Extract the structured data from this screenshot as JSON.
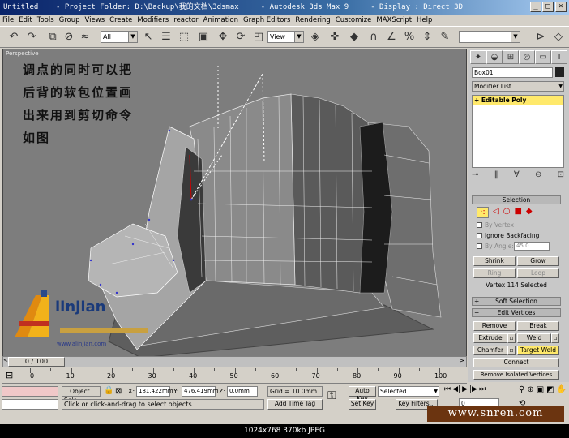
{
  "window": {
    "title": "Untitled    - Project Folder: D:\\Backup\\我的文档\\3dsmax     - Autodesk 3ds Max 9     - Display : Direct 3D",
    "buttons": [
      "_",
      "□",
      "×"
    ]
  },
  "menu": [
    "File",
    "Edit",
    "Tools",
    "Group",
    "Views",
    "Create",
    "Modifiers",
    "reactor",
    "Animation",
    "Graph Editors",
    "Rendering",
    "Customize",
    "MAXScript",
    "Help"
  ],
  "toolbar": {
    "selection_filter": "All",
    "ref_coord": "View"
  },
  "viewport": {
    "label": "Perspective",
    "note_lines": [
      "调点的同时可以把",
      "后背的软包位置画",
      "出来用到剪切命令",
      "如图"
    ],
    "logo": {
      "name": "linjian",
      "url": "www.alinjian.com"
    }
  },
  "command_panel": {
    "object_name": "Box01",
    "modifier_list": "Modifier List",
    "stack_item": "Editable Poly",
    "selection": {
      "header": "Selection",
      "by_vertex": "By Vertex",
      "ignore_backfacing": "Ignore Backfacing",
      "by_angle": "By Angle:",
      "angle_value": "45.0",
      "shrink": "Shrink",
      "grow": "Grow",
      "ring": "Ring",
      "loop": "Loop",
      "status": "Vertex 114 Selected"
    },
    "soft_selection": {
      "header": "Soft Selection"
    },
    "edit_vertices": {
      "header": "Edit Vertices",
      "remove": "Remove",
      "break": "Break",
      "extrude": "Extrude",
      "weld": "Weld",
      "chamfer": "Chamfer",
      "target_weld": "Target Weld",
      "connect": "Connect",
      "remove_isolated": "Remove Isolated Vertices"
    }
  },
  "timeline": {
    "slider_label": "0 / 100",
    "ticks": [
      "0",
      "10",
      "20",
      "30",
      "40",
      "50",
      "60",
      "70",
      "80",
      "90",
      "100"
    ]
  },
  "status": {
    "selection_count": "1 Object Sele",
    "x_label": "X:",
    "x_value": "181.422mm",
    "y_label": "Y:",
    "y_value": "476.419mm",
    "z_label": "Z:",
    "z_value": "0.0mm",
    "grid": "Grid = 10.0mm",
    "auto_key": "Auto Key",
    "auto_key_value": "Selected",
    "set_key": "Set Key",
    "key_filters": "Key Filters...",
    "frame": "0",
    "prompt": "Click or click-and-drag to select objects",
    "add_time_tag": "Add Time Tag"
  },
  "footer": {
    "info": "1024x768  370kb  JPEG"
  },
  "watermark": "www.snren.com",
  "colors": {
    "title_start": "#0a246a",
    "title_end": "#a6caf0",
    "viewport": "#7d7d7d",
    "stack_highlight": "#ffe96b"
  }
}
